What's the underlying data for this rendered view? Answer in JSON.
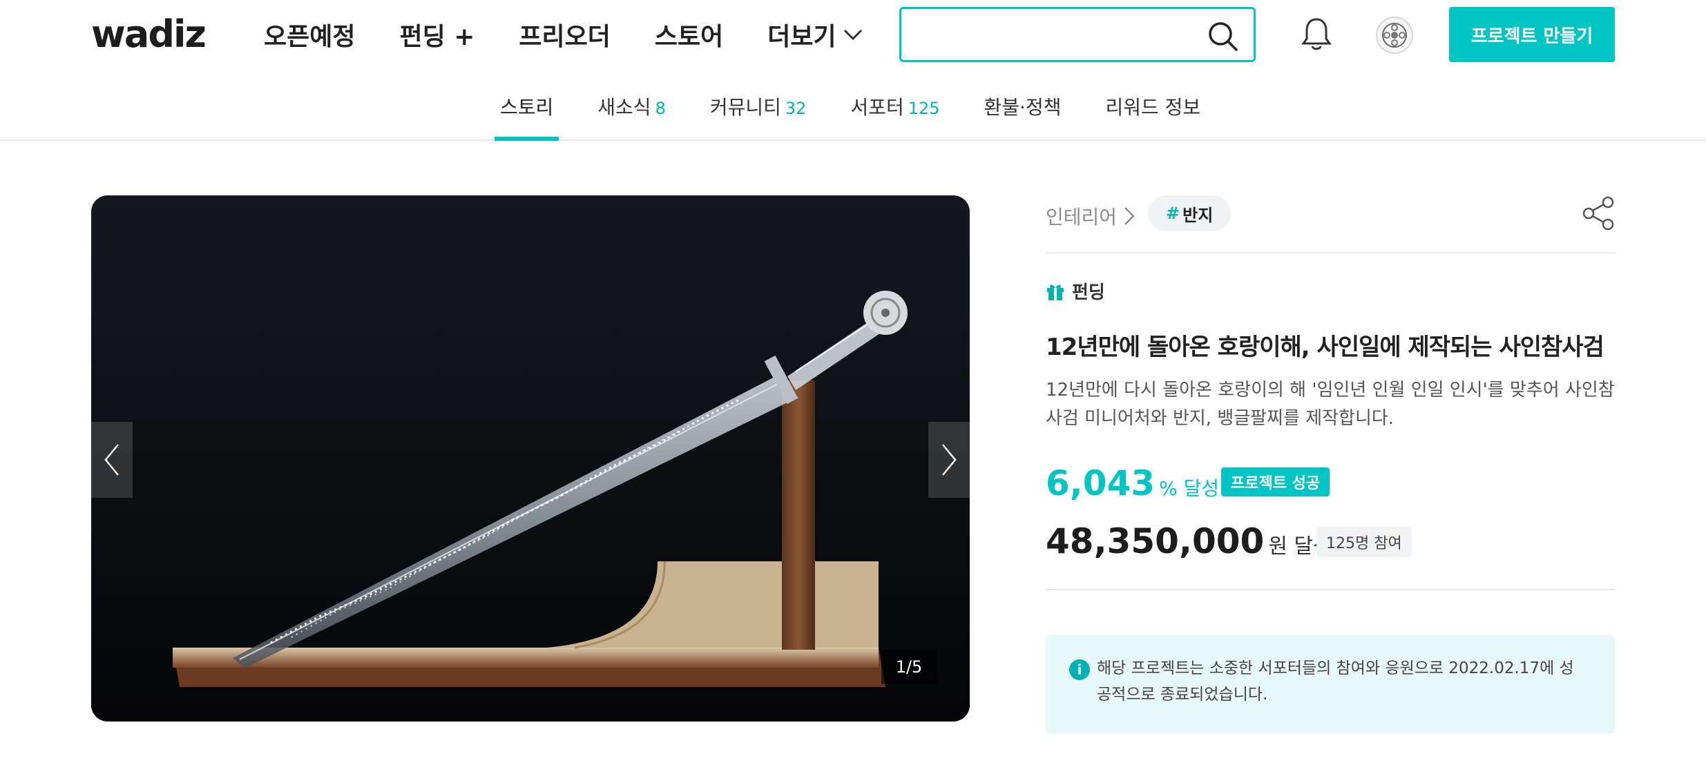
{
  "header": {
    "logo": "wadiz",
    "nav": [
      {
        "label": "오픈예정"
      },
      {
        "label": "펀딩 +"
      },
      {
        "label": "프리오더"
      },
      {
        "label": "스토어"
      },
      {
        "label": "더보기"
      }
    ],
    "search": {
      "value": "",
      "placeholder": ""
    },
    "cta_label": "프로젝트 만들기",
    "icons": {
      "search": "search-icon",
      "notifications": "bell-icon",
      "profile": "avatar-icon"
    }
  },
  "tabs": [
    {
      "label": "스토리",
      "count": "",
      "active": true
    },
    {
      "label": "새소식",
      "count": "8"
    },
    {
      "label": "커뮤니티",
      "count": "32"
    },
    {
      "label": "서포터",
      "count": "125"
    },
    {
      "label": "환불·정책",
      "count": ""
    },
    {
      "label": "리워드 정보",
      "count": ""
    }
  ],
  "gallery": {
    "counter": "1/5",
    "accent": "#00c4c4"
  },
  "project": {
    "category": "인테리어",
    "tag_hash": "#",
    "tag": "반지",
    "type_label": "펀딩",
    "title": "12년만에 돌아온 호랑이해, 사인일에 제작되는 사인참사검",
    "description": "12년만에 다시 돌아온 호랑이의 해 '임인년 인월 인일 인시'를 맞추어 사인참사검 미니어처와 반지, 뱅글팔찌를 제작합니다.",
    "rate": "6,043",
    "rate_unit": "% 달성",
    "status_badge": "프로젝트 성공",
    "amount": "48,350,000",
    "amount_unit": "원 달성",
    "supporters": "125명 참여",
    "notice": "해당 프로젝트는 소중한 서포터들의 참여와 응원으로 2022.02.17에 성공적으로 종료되었습니다.",
    "notice_icon": "i"
  },
  "colors": {
    "brand": "#00c4c4",
    "notice_bg": "#e8f8f8"
  }
}
